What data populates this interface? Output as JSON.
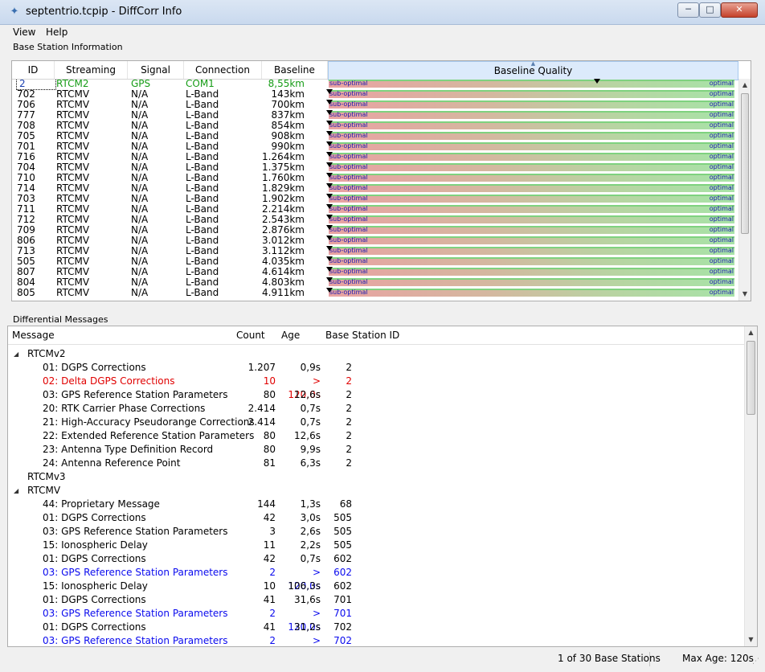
{
  "window": {
    "title": "septentrio.tcpip - DiffCorr Info",
    "minimize": "─",
    "maximize": "□",
    "close": "✕"
  },
  "menu": [
    "View",
    "Help"
  ],
  "base_station": {
    "group_label": "Base Station Information",
    "columns": {
      "id": "ID",
      "streaming": "Streaming",
      "signal": "Signal",
      "connection": "Connection",
      "baseline": "Baseline",
      "quality": "Baseline Quality"
    },
    "quality_labels": {
      "low": "sub-optimal",
      "high": "optimal"
    },
    "rows": [
      {
        "id": "2",
        "streaming": "RTCM2",
        "signal": "GPS",
        "connection": "COM1",
        "baseline": "8,55km",
        "quality": 0.66,
        "active": true
      },
      {
        "id": "702",
        "streaming": "RTCMV",
        "signal": "N/A",
        "connection": "L-Band",
        "baseline": "143km",
        "quality": 0.0
      },
      {
        "id": "706",
        "streaming": "RTCMV",
        "signal": "N/A",
        "connection": "L-Band",
        "baseline": "700km",
        "quality": 0.0
      },
      {
        "id": "777",
        "streaming": "RTCMV",
        "signal": "N/A",
        "connection": "L-Band",
        "baseline": "837km",
        "quality": 0.0
      },
      {
        "id": "708",
        "streaming": "RTCMV",
        "signal": "N/A",
        "connection": "L-Band",
        "baseline": "854km",
        "quality": 0.0
      },
      {
        "id": "705",
        "streaming": "RTCMV",
        "signal": "N/A",
        "connection": "L-Band",
        "baseline": "908km",
        "quality": 0.0
      },
      {
        "id": "701",
        "streaming": "RTCMV",
        "signal": "N/A",
        "connection": "L-Band",
        "baseline": "990km",
        "quality": 0.0
      },
      {
        "id": "716",
        "streaming": "RTCMV",
        "signal": "N/A",
        "connection": "L-Band",
        "baseline": "1.264km",
        "quality": 0.0
      },
      {
        "id": "704",
        "streaming": "RTCMV",
        "signal": "N/A",
        "connection": "L-Band",
        "baseline": "1.375km",
        "quality": 0.0
      },
      {
        "id": "710",
        "streaming": "RTCMV",
        "signal": "N/A",
        "connection": "L-Band",
        "baseline": "1.760km",
        "quality": 0.0
      },
      {
        "id": "714",
        "streaming": "RTCMV",
        "signal": "N/A",
        "connection": "L-Band",
        "baseline": "1.829km",
        "quality": 0.0
      },
      {
        "id": "703",
        "streaming": "RTCMV",
        "signal": "N/A",
        "connection": "L-Band",
        "baseline": "1.902km",
        "quality": 0.0
      },
      {
        "id": "711",
        "streaming": "RTCMV",
        "signal": "N/A",
        "connection": "L-Band",
        "baseline": "2.214km",
        "quality": 0.0
      },
      {
        "id": "712",
        "streaming": "RTCMV",
        "signal": "N/A",
        "connection": "L-Band",
        "baseline": "2.543km",
        "quality": 0.0
      },
      {
        "id": "709",
        "streaming": "RTCMV",
        "signal": "N/A",
        "connection": "L-Band",
        "baseline": "2.876km",
        "quality": 0.0
      },
      {
        "id": "806",
        "streaming": "RTCMV",
        "signal": "N/A",
        "connection": "L-Band",
        "baseline": "3.012km",
        "quality": 0.0
      },
      {
        "id": "713",
        "streaming": "RTCMV",
        "signal": "N/A",
        "connection": "L-Band",
        "baseline": "3.112km",
        "quality": 0.0
      },
      {
        "id": "505",
        "streaming": "RTCMV",
        "signal": "N/A",
        "connection": "L-Band",
        "baseline": "4.035km",
        "quality": 0.0
      },
      {
        "id": "807",
        "streaming": "RTCMV",
        "signal": "N/A",
        "connection": "L-Band",
        "baseline": "4.614km",
        "quality": 0.0
      },
      {
        "id": "804",
        "streaming": "RTCMV",
        "signal": "N/A",
        "connection": "L-Band",
        "baseline": "4.803km",
        "quality": 0.0
      },
      {
        "id": "805",
        "streaming": "RTCMV",
        "signal": "N/A",
        "connection": "L-Band",
        "baseline": "4.911km",
        "quality": 0.0
      }
    ]
  },
  "diff_messages": {
    "group_label": "Differential Messages",
    "columns": {
      "message": "Message",
      "count": "Count",
      "age": "Age",
      "bsid": "Base Station ID"
    },
    "rows": [
      {
        "type": "cat",
        "label": "RTCMv2",
        "expanded": true
      },
      {
        "type": "msg",
        "message": "01: DGPS Corrections",
        "count": "1.207",
        "age": "0,9s",
        "bsid": "2",
        "style": "normal"
      },
      {
        "type": "msg",
        "message": "02: Delta DGPS Corrections",
        "count": "10",
        "age": "> 120,0s",
        "bsid": "2",
        "style": "red"
      },
      {
        "type": "msg",
        "message": "03: GPS Reference Station Parameters",
        "count": "80",
        "age": "12,6s",
        "bsid": "2",
        "style": "normal"
      },
      {
        "type": "msg",
        "message": "20: RTK Carrier Phase Corrections",
        "count": "2.414",
        "age": "0,7s",
        "bsid": "2",
        "style": "normal"
      },
      {
        "type": "msg",
        "message": "21: High-Accuracy Pseudorange Corrections",
        "count": "2.414",
        "age": "0,7s",
        "bsid": "2",
        "style": "normal"
      },
      {
        "type": "msg",
        "message": "22: Extended Reference Station Parameters",
        "count": "80",
        "age": "12,6s",
        "bsid": "2",
        "style": "normal"
      },
      {
        "type": "msg",
        "message": "23: Antenna Type Definition Record",
        "count": "80",
        "age": "9,9s",
        "bsid": "2",
        "style": "normal"
      },
      {
        "type": "msg",
        "message": "24: Antenna Reference Point",
        "count": "81",
        "age": "6,3s",
        "bsid": "2",
        "style": "normal"
      },
      {
        "type": "cat",
        "label": "RTCMv3",
        "expanded": false
      },
      {
        "type": "cat",
        "label": "RTCMV",
        "expanded": true
      },
      {
        "type": "msg",
        "message": "44: Proprietary Message",
        "count": "144",
        "age": "1,3s",
        "bsid": "68",
        "style": "normal"
      },
      {
        "type": "msg",
        "message": "01: DGPS Corrections",
        "count": "42",
        "age": "3,0s",
        "bsid": "505",
        "style": "normal"
      },
      {
        "type": "msg",
        "message": "03: GPS Reference Station Parameters",
        "count": "3",
        "age": "2,6s",
        "bsid": "505",
        "style": "normal"
      },
      {
        "type": "msg",
        "message": "15: Ionospheric Delay",
        "count": "11",
        "age": "2,2s",
        "bsid": "505",
        "style": "normal"
      },
      {
        "type": "msg",
        "message": "01: DGPS Corrections",
        "count": "42",
        "age": "0,7s",
        "bsid": "602",
        "style": "normal"
      },
      {
        "type": "msg",
        "message": "03: GPS Reference Station Parameters",
        "count": "2",
        "age": "> 120,0s",
        "bsid": "602",
        "style": "blue"
      },
      {
        "type": "msg",
        "message": "15: Ionospheric Delay",
        "count": "10",
        "age": "106,3s",
        "bsid": "602",
        "style": "normal"
      },
      {
        "type": "msg",
        "message": "01: DGPS Corrections",
        "count": "41",
        "age": "31,6s",
        "bsid": "701",
        "style": "normal"
      },
      {
        "type": "msg",
        "message": "03: GPS Reference Station Parameters",
        "count": "2",
        "age": "> 120,0s",
        "bsid": "701",
        "style": "blue"
      },
      {
        "type": "msg",
        "message": "01: DGPS Corrections",
        "count": "41",
        "age": "31,2s",
        "bsid": "702",
        "style": "normal"
      },
      {
        "type": "msg",
        "message": "03: GPS Reference Station Parameters",
        "count": "2",
        "age": "> 120,0s",
        "bsid": "702",
        "style": "blue"
      }
    ]
  },
  "status": {
    "stations": "1 of 30 Base Stations",
    "max_age": "Max Age: 120s"
  }
}
